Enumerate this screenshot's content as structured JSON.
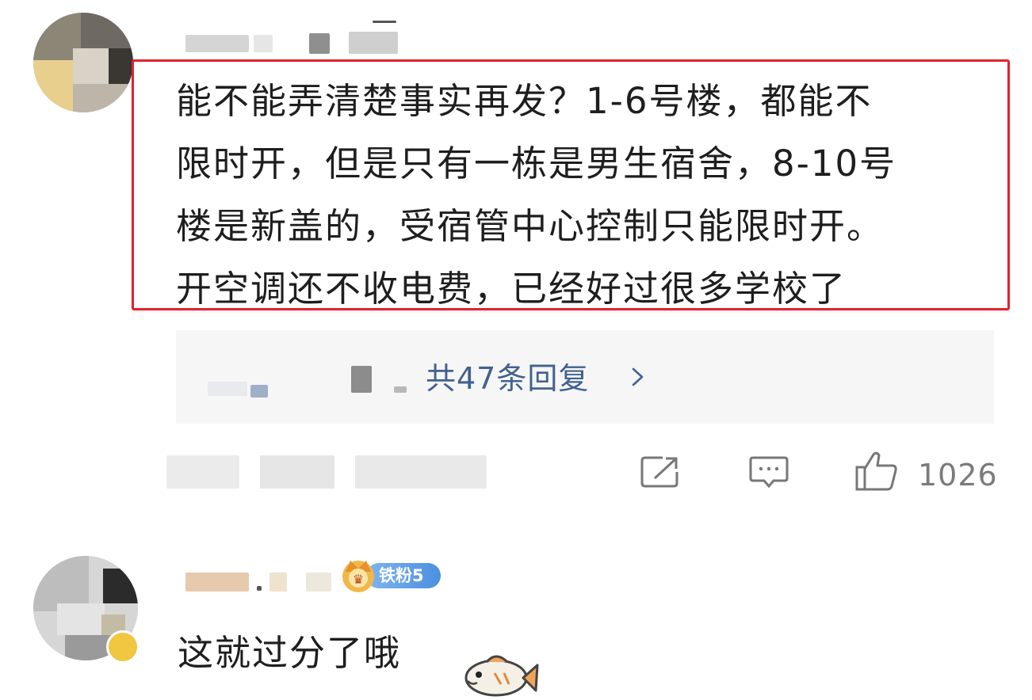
{
  "comment1": {
    "text": "能不能弄清楚事实再发？1-6号楼，都能不\n限时开，但是只有一栋是男生宿舍，8-10号\n楼是新盖的，受宿管中心控制只能限时开。\n开空调还不收电费，已经好过很多学校了",
    "replies_label": "共47条回复",
    "like_count": "1026",
    "highlight_color": "#e0242e"
  },
  "comment2": {
    "text": "这就过分了哦",
    "badge_label": "铁粉5"
  },
  "colors": {
    "link": "#41628f",
    "replies_bg": "#f6f6f7",
    "muted": "#7b7b7b"
  },
  "icons": {
    "share": "share-icon",
    "comment": "comment-icon",
    "like": "thumbs-up-icon",
    "chevron": "chevron-right-icon",
    "fish_sticker": "fish-sticker-icon",
    "fan_badge": "crown-badge-icon"
  }
}
